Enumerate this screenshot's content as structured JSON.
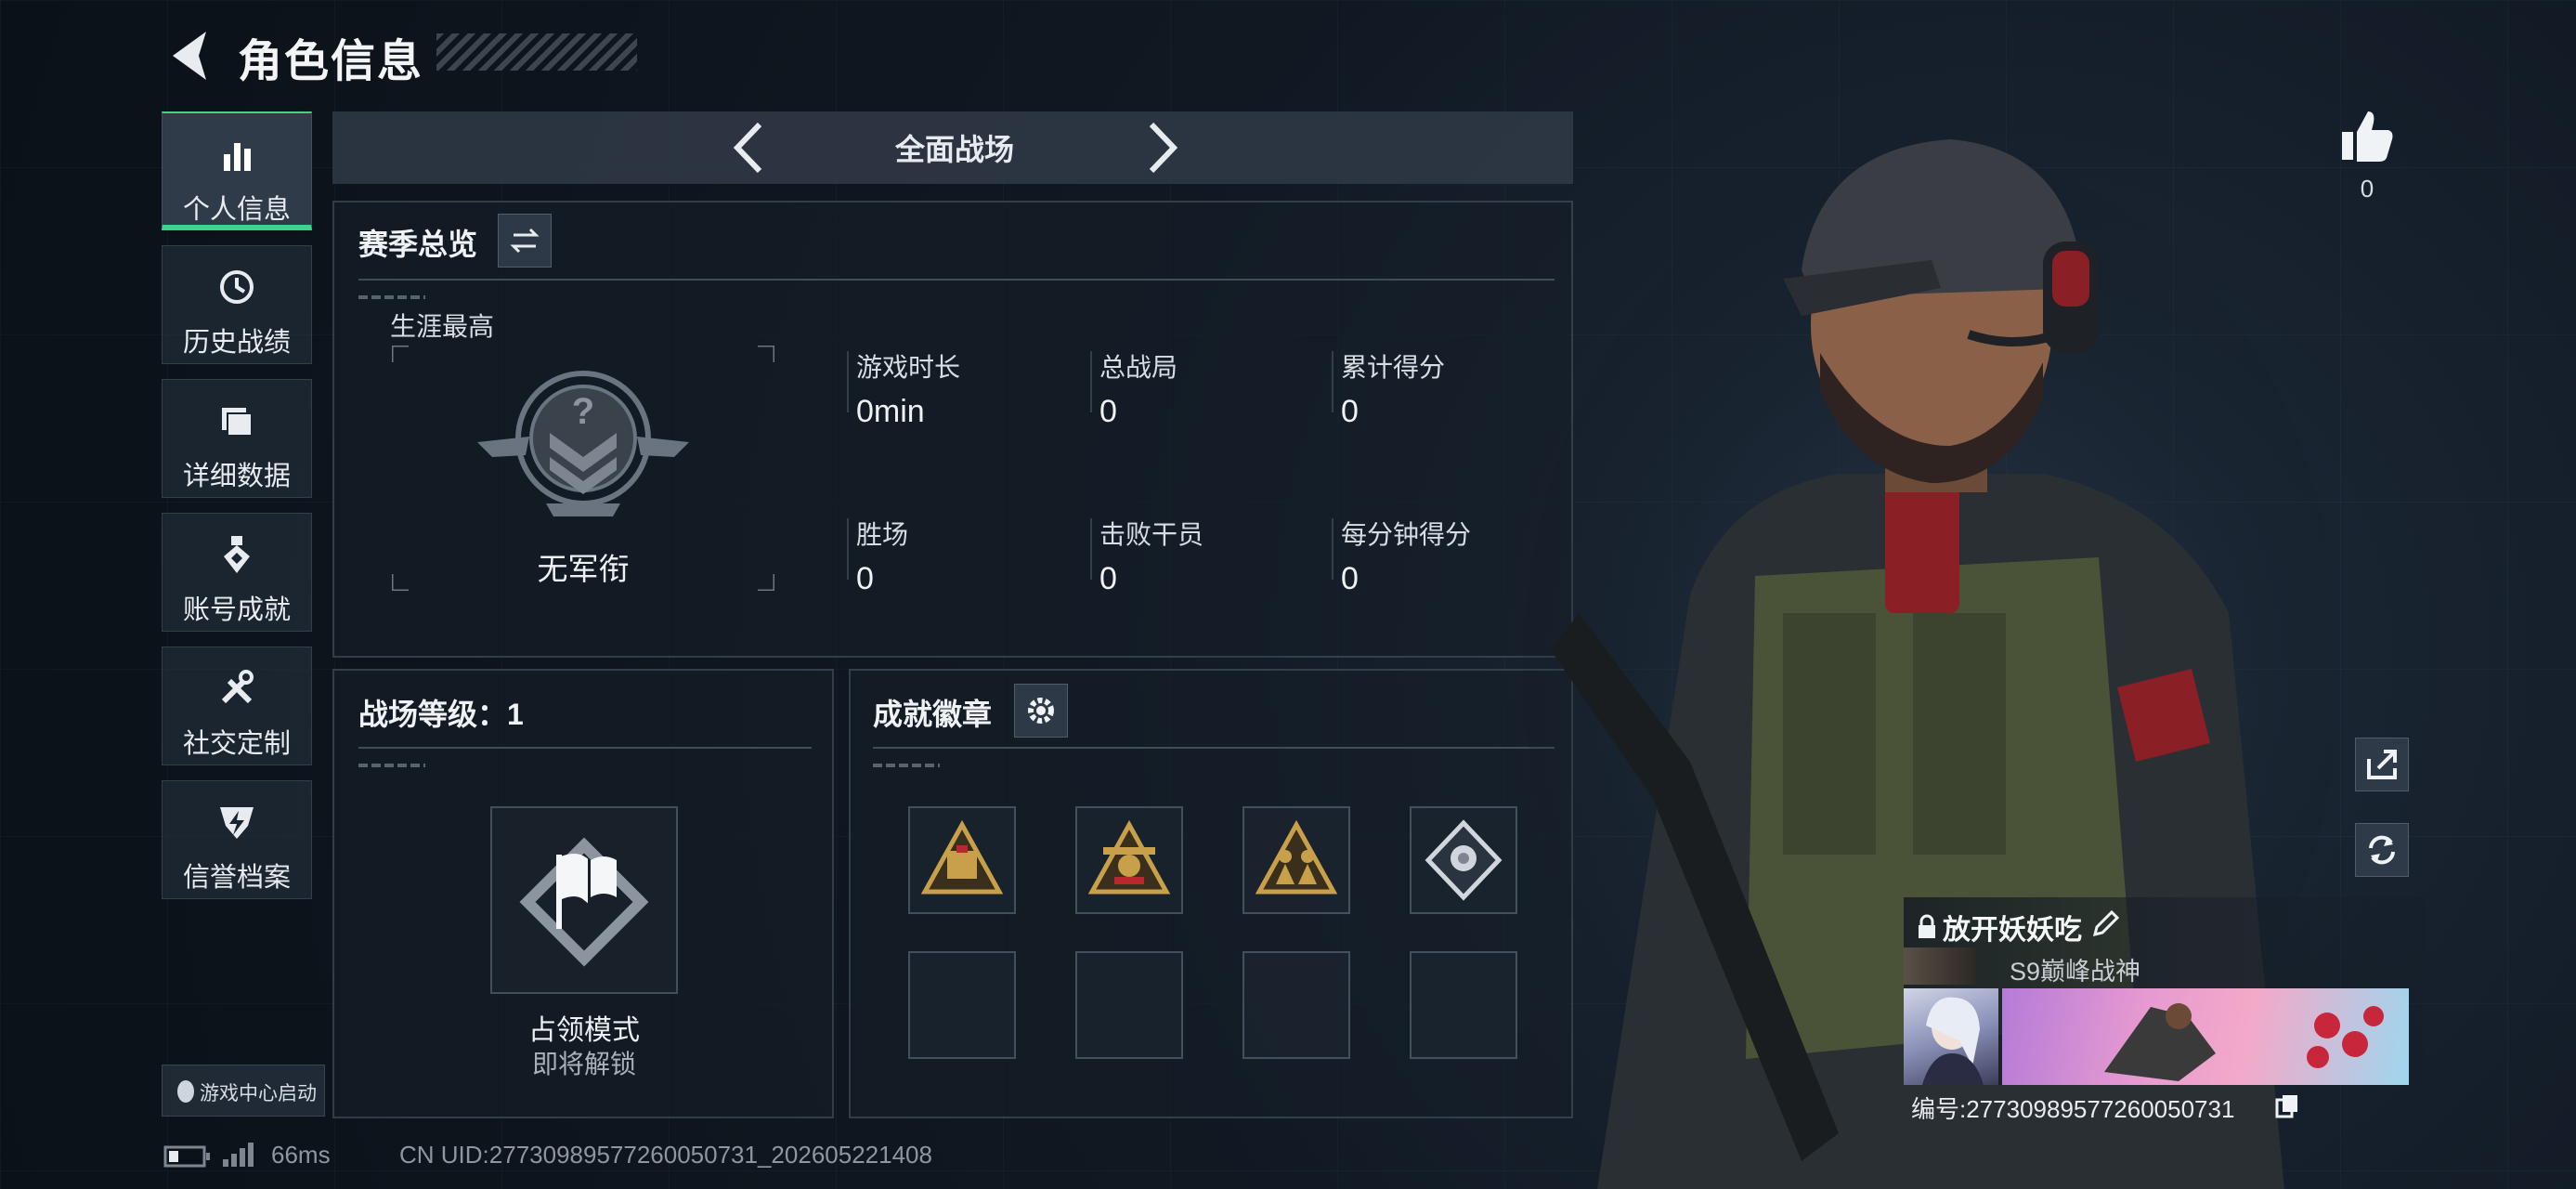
{
  "header": {
    "title": "角色信息"
  },
  "sidebar": {
    "items": [
      {
        "label": "个人信息"
      },
      {
        "label": "历史战绩"
      },
      {
        "label": "详细数据"
      },
      {
        "label": "账号成就"
      },
      {
        "label": "社交定制"
      },
      {
        "label": "信誉档案"
      }
    ],
    "launch_label": "游戏中心启动"
  },
  "mode": {
    "title": "全面战场"
  },
  "season": {
    "title": "赛季总览",
    "career_label": "生涯最高",
    "rank_label": "无军衔",
    "stats": [
      {
        "label": "游戏时长",
        "value": "0min"
      },
      {
        "label": "总战局",
        "value": "0"
      },
      {
        "label": "累计得分",
        "value": "0"
      },
      {
        "label": "胜场",
        "value": "0"
      },
      {
        "label": "击败干员",
        "value": "0"
      },
      {
        "label": "每分钟得分",
        "value": "0"
      }
    ]
  },
  "level": {
    "title": "战场等级：1",
    "mode_label": "占领模式",
    "unlock_label": "即将解锁"
  },
  "badges": {
    "title": "成就徽章"
  },
  "like": {
    "count": "0"
  },
  "profile": {
    "name": "放开妖妖吃",
    "subtitle": "S9巅峰战神",
    "id_text": "编号:27730989577260050731"
  },
  "status": {
    "ping": "66ms",
    "uid": "CN UID:27730989577260050731_202605221408"
  },
  "colors": {
    "accent": "#3fd38a",
    "badge_red": "#b8282e",
    "badge_gold": "#c8a04a"
  }
}
